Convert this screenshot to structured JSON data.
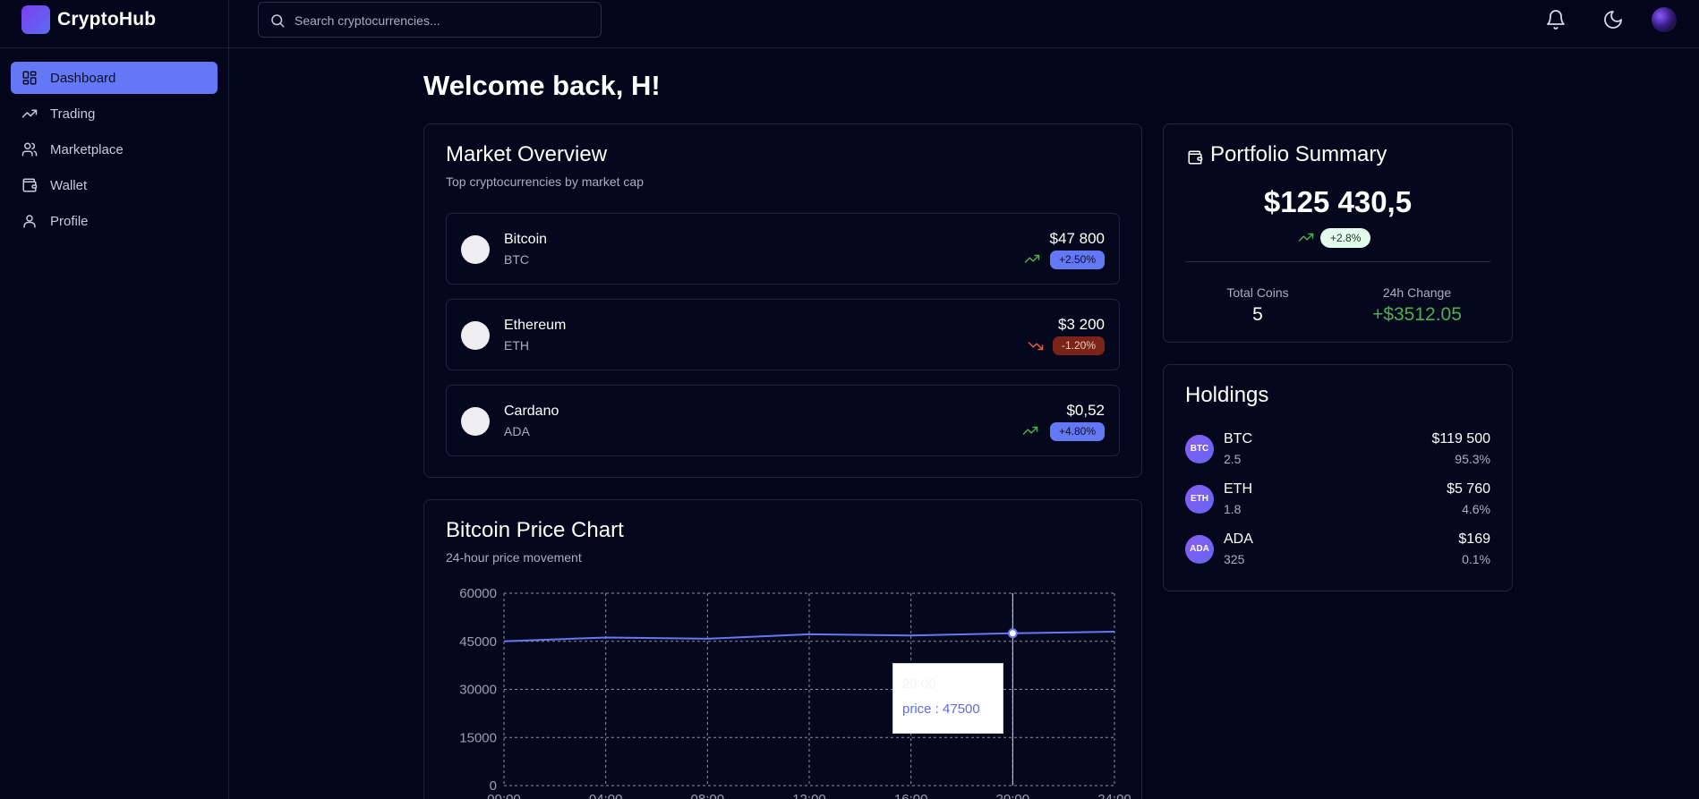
{
  "app": {
    "brand": "CryptoHub"
  },
  "search": {
    "placeholder": "Search cryptocurrencies..."
  },
  "sidebar": {
    "items": [
      {
        "label": "Dashboard",
        "icon": "dashboard-icon",
        "active": true
      },
      {
        "label": "Trading",
        "icon": "trending-up-icon"
      },
      {
        "label": "Marketplace",
        "icon": "users-icon"
      },
      {
        "label": "Wallet",
        "icon": "wallet-icon"
      },
      {
        "label": "Profile",
        "icon": "user-icon"
      }
    ]
  },
  "welcome": "Welcome back, H!",
  "market": {
    "title": "Market Overview",
    "subtitle": "Top cryptocurrencies by market cap",
    "coins": [
      {
        "name": "Bitcoin",
        "symbol": "BTC",
        "price": "$47 800",
        "change": "+2.50%",
        "direction": "up"
      },
      {
        "name": "Ethereum",
        "symbol": "ETH",
        "price": "$3 200",
        "change": "-1.20%",
        "direction": "down"
      },
      {
        "name": "Cardano",
        "symbol": "ADA",
        "price": "$0,52",
        "change": "+4.80%",
        "direction": "up"
      }
    ]
  },
  "portfolio": {
    "title": "Portfolio Summary",
    "total": "$125 430,5",
    "change": "+2.8%",
    "total_coins_label": "Total Coins",
    "total_coins": "5",
    "change_24h_label": "24h Change",
    "change_24h": "+$3512.05"
  },
  "holdings": {
    "title": "Holdings",
    "items": [
      {
        "symbol": "BTC",
        "amount": "2.5",
        "value": "$119 500",
        "percent": "95.3%"
      },
      {
        "symbol": "ETH",
        "amount": "1.8",
        "value": "$5 760",
        "percent": "4.6%"
      },
      {
        "symbol": "ADA",
        "amount": "325",
        "value": "$169",
        "percent": "0.1%"
      }
    ]
  },
  "price_chart": {
    "title": "Bitcoin Price Chart",
    "subtitle": "24-hour price movement"
  },
  "colors": {
    "accent": "#6478f5",
    "positive": "#4caf50",
    "negative": "#7a2418",
    "background": "#03051a"
  },
  "chart_data": {
    "type": "line",
    "x": [
      "00:00",
      "04:00",
      "08:00",
      "12:00",
      "16:00",
      "20:00",
      "24:00"
    ],
    "series": [
      {
        "values": [
          45000,
          46200,
          45800,
          47200,
          46800,
          47500,
          48000
        ]
      }
    ],
    "yticks": [
      "0",
      "15000",
      "30000",
      "45000",
      "60000"
    ],
    "ylim": [
      0,
      60000
    ],
    "grid": true,
    "tooltip": {
      "time": "20:00",
      "label": "price",
      "value": "47500"
    }
  }
}
